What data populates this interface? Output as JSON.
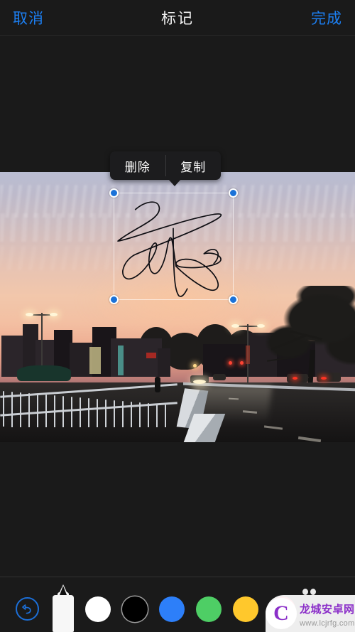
{
  "navbar": {
    "cancel_label": "取消",
    "title": "标记",
    "done_label": "完成",
    "accent_color": "#1c7ff2",
    "title_color": "#f2f2f2"
  },
  "context_menu": {
    "delete_label": "删除",
    "copy_label": "复制",
    "background_color": "#1c1c1e"
  },
  "selection": {
    "handle_color": "#1b72d8",
    "handle_ring_color": "#ffffff",
    "border_color": "rgba(255,255,255,0.62)",
    "content": "handwritten-signature"
  },
  "photo": {
    "description": "黄昏城市道路照片",
    "sky_top_color": "#b9bdd2",
    "sky_mid_color": "#f2c7ab",
    "road_color": "#262423"
  },
  "toolbar": {
    "undo_label": "撤销",
    "undo_color": "#1c6fd8",
    "pen_label": "记号笔",
    "pen_color": "#f7f7f7",
    "selected_color": "#000000",
    "colors": [
      {
        "name": "white",
        "hex": "#FFFFFF",
        "selected": false
      },
      {
        "name": "black",
        "hex": "#000000",
        "selected": true
      },
      {
        "name": "blue",
        "hex": "#2D7FF9",
        "selected": false
      },
      {
        "name": "green",
        "hex": "#4ECE65",
        "selected": false
      },
      {
        "name": "yellow",
        "hex": "#FFC82C",
        "selected": false
      },
      {
        "name": "red",
        "hex": "#FF3A49",
        "selected": false
      }
    ]
  },
  "watermark": {
    "logo_letter": "C",
    "site_name": "龙城安卓网",
    "url": "www.lcjrfg.com",
    "brand_color": "#8b2fc9"
  }
}
